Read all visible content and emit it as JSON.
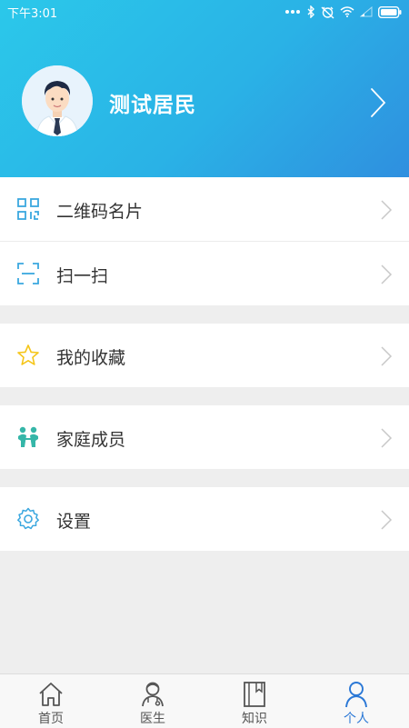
{
  "status_bar": {
    "time": "下午3:01",
    "icons": [
      "dots-icon",
      "bluetooth-icon",
      "alarm-off-icon",
      "wifi-icon",
      "signal-icon",
      "battery-icon"
    ]
  },
  "profile": {
    "name": "测试居民",
    "avatar": "user-avatar"
  },
  "menu": {
    "groups": [
      {
        "items": [
          {
            "label": "二维码名片",
            "icon": "qrcode-icon"
          },
          {
            "label": "扫一扫",
            "icon": "scan-icon"
          }
        ]
      },
      {
        "items": [
          {
            "label": "我的收藏",
            "icon": "star-icon"
          }
        ]
      },
      {
        "items": [
          {
            "label": "家庭成员",
            "icon": "family-icon"
          }
        ]
      },
      {
        "items": [
          {
            "label": "设置",
            "icon": "gear-icon"
          }
        ]
      }
    ]
  },
  "tabbar": {
    "tabs": [
      {
        "label": "首页",
        "icon": "home-icon"
      },
      {
        "label": "医生",
        "icon": "doctor-icon"
      },
      {
        "label": "知识",
        "icon": "book-icon"
      },
      {
        "label": "个人",
        "icon": "person-icon",
        "active": true
      }
    ]
  },
  "colors": {
    "header_start": "#2bc8ea",
    "header_end": "#2f8fdf",
    "accent": "#2b78d6",
    "icon_blue": "#3aa7df",
    "icon_star": "#f5c518",
    "icon_family": "#35b6a8"
  }
}
